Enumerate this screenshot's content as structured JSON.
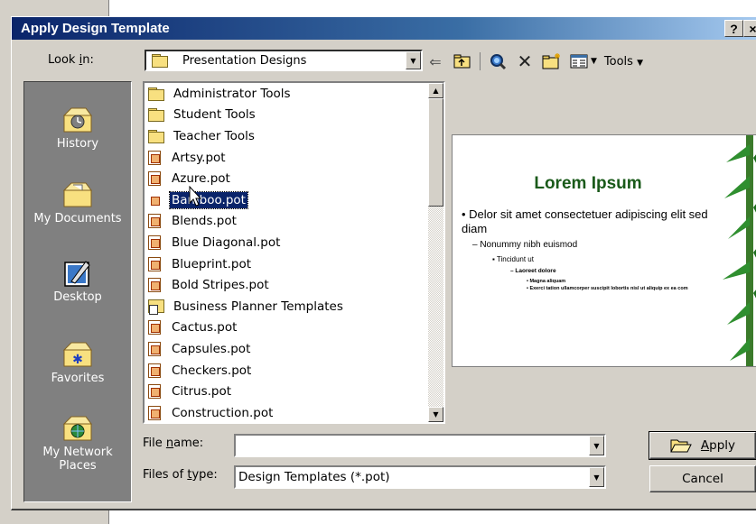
{
  "dialog": {
    "title": "Apply Design Template",
    "help_button": "?",
    "close_button": "×"
  },
  "look_in": {
    "label_pre": "Look ",
    "label_ul": "i",
    "label_post": "n:",
    "value": "Presentation Designs"
  },
  "toolbar": {
    "tools_label": "Tools",
    "icons": [
      "back-arrow-icon",
      "up-one-level-icon",
      "search-web-icon",
      "delete-icon",
      "new-folder-icon",
      "views-icon"
    ]
  },
  "places": [
    {
      "label": "History",
      "icon": "history-icon"
    },
    {
      "label": "My Documents",
      "icon": "my-documents-icon"
    },
    {
      "label": "Desktop",
      "icon": "desktop-icon"
    },
    {
      "label": "Favorites",
      "icon": "favorites-icon"
    },
    {
      "label": "My Network Places",
      "icon": "network-places-icon"
    }
  ],
  "files": [
    {
      "name": "Administrator Tools",
      "type": "folder"
    },
    {
      "name": "Student Tools",
      "type": "folder"
    },
    {
      "name": "Teacher Tools",
      "type": "folder"
    },
    {
      "name": "Artsy.pot",
      "type": "pot"
    },
    {
      "name": "Azure.pot",
      "type": "pot"
    },
    {
      "name": "Bamboo.pot",
      "type": "pot",
      "selected": true
    },
    {
      "name": "Blends.pot",
      "type": "pot"
    },
    {
      "name": "Blue Diagonal.pot",
      "type": "pot"
    },
    {
      "name": "Blueprint.pot",
      "type": "pot"
    },
    {
      "name": "Bold Stripes.pot",
      "type": "pot"
    },
    {
      "name": "Business Planner Templates",
      "type": "shortcut-folder"
    },
    {
      "name": "Cactus.pot",
      "type": "pot"
    },
    {
      "name": "Capsules.pot",
      "type": "pot"
    },
    {
      "name": "Checkers.pot",
      "type": "pot"
    },
    {
      "name": "Citrus.pot",
      "type": "pot"
    },
    {
      "name": "Construction.pot",
      "type": "pot"
    }
  ],
  "preview": {
    "title": "Lorem Ipsum",
    "bullet1": "Delor sit amet consectetuer adipiscing elit sed diam",
    "bullet2": "– Nonummy nibh euismod",
    "bullet3": "▪ Tincidunt ut",
    "bullet4": "– Laoreet dolore",
    "bullet5": "• Magna aliquam",
    "bullet6": "• Exerci tation ullamcorper suscipit lobortis nisl ut aliquip ex ea com",
    "accent_color": "#1a5a1a"
  },
  "file_name": {
    "label_pre": "File ",
    "label_ul": "n",
    "label_post": "ame:",
    "value": ""
  },
  "files_of_type": {
    "label_pre": "Files of ",
    "label_ul": "t",
    "label_post": "ype:",
    "value": "Design Templates (*.pot)"
  },
  "buttons": {
    "apply_ul": "A",
    "apply_rest": "pply",
    "cancel": "Cancel"
  }
}
